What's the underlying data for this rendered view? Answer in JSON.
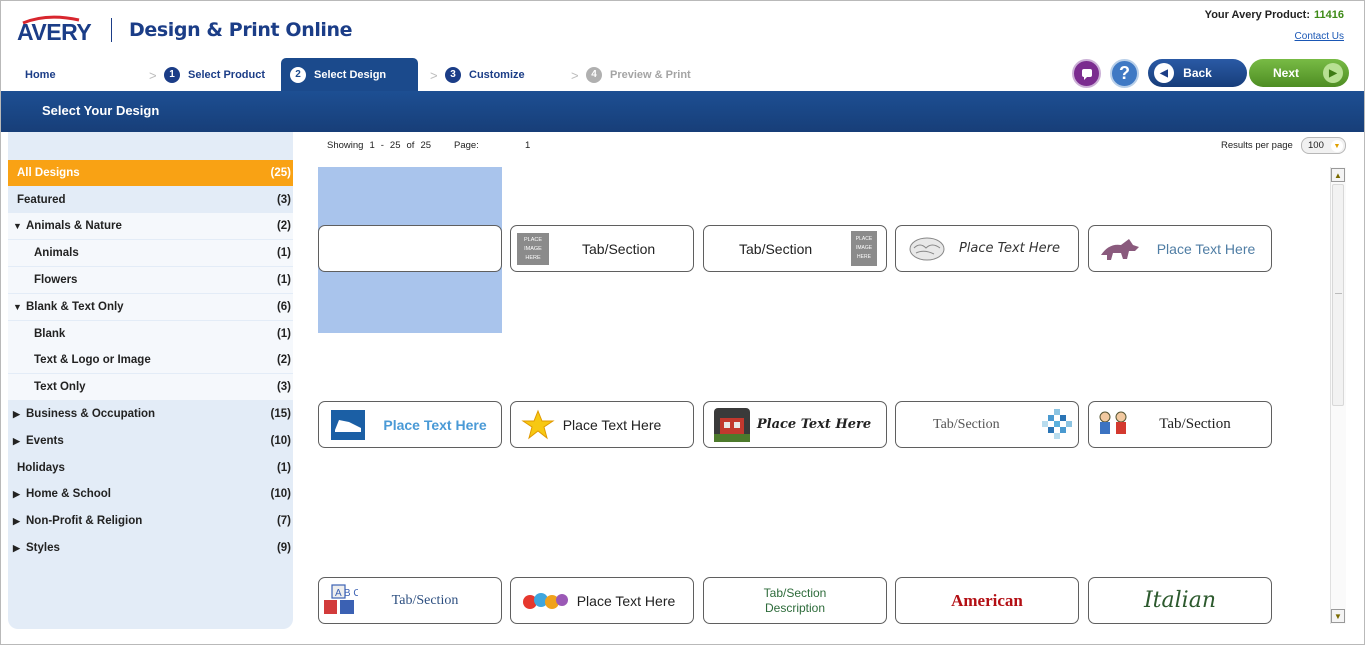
{
  "header": {
    "logo": "AVERY",
    "app_title": "Design & Print Online",
    "product_label": "Your Avery Product:",
    "product_number": "11416",
    "contact_link": "Contact Us"
  },
  "steps": {
    "home": "Home",
    "select_product": {
      "num": "1",
      "label": "Select Product"
    },
    "select_design": {
      "num": "2",
      "label": "Select Design"
    },
    "customize": {
      "num": "3",
      "label": "Customize"
    },
    "preview": {
      "num": "4",
      "label": "Preview & Print"
    }
  },
  "buttons": {
    "help": "?",
    "back": "Back",
    "next": "Next"
  },
  "section_title": "Select Your Design",
  "sidebar": {
    "categories": [
      {
        "label": "All Designs",
        "count": "(25)"
      },
      {
        "label": "Featured",
        "count": "(3)"
      },
      {
        "label": "Animals & Nature",
        "count": "(2)"
      },
      {
        "label": "Animals",
        "count": "(1)"
      },
      {
        "label": "Flowers",
        "count": "(1)"
      },
      {
        "label": "Blank & Text Only",
        "count": "(6)"
      },
      {
        "label": "Blank",
        "count": "(1)"
      },
      {
        "label": "Text & Logo or Image",
        "count": "(2)"
      },
      {
        "label": "Text Only",
        "count": "(3)"
      },
      {
        "label": "Business & Occupation",
        "count": "(15)"
      },
      {
        "label": "Events",
        "count": "(10)"
      },
      {
        "label": "Holidays",
        "count": "(1)"
      },
      {
        "label": "Home & School",
        "count": "(10)"
      },
      {
        "label": "Non-Profit & Religion",
        "count": "(7)"
      },
      {
        "label": "Styles",
        "count": "(9)"
      }
    ]
  },
  "results": {
    "showing_label": "Showing",
    "from": "1",
    "dash": "-",
    "to": "25",
    "of_label": "of",
    "total": "25",
    "page_label": "Page:",
    "page": "1",
    "per_page_label": "Results per page",
    "per_page": "100"
  },
  "tiles": [
    {
      "text": ""
    },
    {
      "text": "Tab/Section",
      "icon_text": "PLACE IMAGE HERE"
    },
    {
      "text": "Tab/Section",
      "icon_text": "PLACE IMAGE HERE"
    },
    {
      "text": "Place Text Here"
    },
    {
      "text": "Place Text Here"
    },
    {
      "text": "Place Text Here"
    },
    {
      "text": "Place Text Here"
    },
    {
      "text": "Place Text Here"
    },
    {
      "text": "Tab/Section"
    },
    {
      "text": "Tab/Section"
    },
    {
      "text": "Tab/Section",
      "icon_text": "A B C"
    },
    {
      "text": "Place Text Here"
    },
    {
      "text": "Tab/Section",
      "text2": "Description"
    },
    {
      "text": "American"
    },
    {
      "text": "Italian"
    }
  ],
  "colors": {
    "brand_blue": "#1b3d87",
    "active_orange": "#f9a214",
    "next_green": "#5a9b2a",
    "selected_highlight": "#a9c4ec"
  }
}
